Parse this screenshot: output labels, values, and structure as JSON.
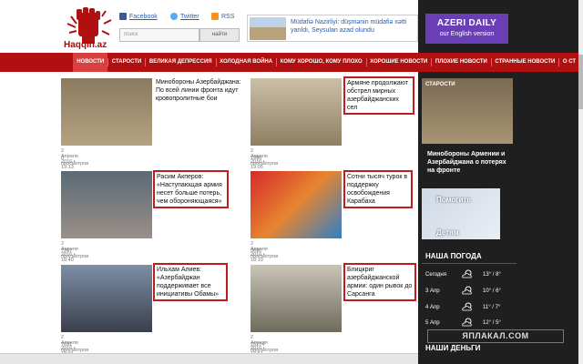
{
  "header": {
    "logo_text": "Haqqin.az",
    "facebook": "Facebook",
    "twitter": "Twitter",
    "rss": "RSS",
    "search_placeholder": "поиск",
    "search_button": "найти",
    "banner_text": "Müdafiə Nazirliyi: düşmənin müdafiə xətti yarıldı, Seysulan azad olundu",
    "azeri_title": "AZERI DAILY",
    "azeri_sub": "our English version"
  },
  "nav": [
    "НОВОСТИ",
    "СТАРОСТИ",
    "ВЕЛИКАЯ ДЕПРЕССИЯ",
    "ХОЛОДНАЯ ВОЙНА",
    "КОМУ ХОРОШО, КОМУ ПЛОХО",
    "ХОРОШИЕ НОВОСТИ",
    "ПЛОХИЕ НОВОСТИ",
    "СТРАННЫЕ НОВОСТИ",
    "О СТ"
  ],
  "cards": [
    {
      "title": "Минобороны Азербайджана: По всей линии фронта идут кровопролитные бои",
      "date": "2 Апреля 2016 • 19:13",
      "views": "0 просмотров"
    },
    {
      "title": "Армяне продолжают обстрел мирных азербайджанских сел",
      "date": "2 Апреля 2016 • 19:05",
      "views": "1990 просмотров"
    },
    {
      "title": "Расим Акперов: «Наступающая армия несет больше потерь, чем обороняющаяся»",
      "date": "2 Апреля 2016 • 18:40",
      "views": "7267 просмотров"
    },
    {
      "title": "Сотни тысяч турок в поддержку освобождения Карабаха",
      "date": "2 Апреля 2016 • 18:10",
      "views": "9690 просмотров"
    },
    {
      "title": "Ильхам Алиев: «Азербайджан поддерживает все инициативы Обамы»",
      "date": "2 Апреля 2016 • 18:01",
      "views": "7631 просмотров"
    },
    {
      "title": "Блицкриг азербайджанской армии: один рывок до Сарсанга",
      "date": "2 Апреля 2016 • 17:51",
      "views": "15274 просмотров"
    }
  ],
  "sidebar": {
    "image_label": "СТАРОСТИ",
    "caption": "Минобороны Армении и Азербайджана о потерях на фронте",
    "ad_top": "Помогите",
    "ad_bottom": "Детям",
    "weather_title": "НАША ПОГОДА",
    "weather": [
      {
        "day": "Сегодня",
        "temp": "13° / 8°"
      },
      {
        "day": "3 Апр",
        "temp": "10° / 6°"
      },
      {
        "day": "4 Апр",
        "temp": "11° / 7°"
      },
      {
        "day": "5 Апр",
        "temp": "12° / 5°"
      }
    ],
    "money_title": "НАШИ ДЕНЬГИ",
    "watermark": "ЯПЛАКАЛ.COM"
  },
  "colors": {
    "nav": "#b01010",
    "accent_box": "#c01c1c",
    "azeri": "#6a3fb5",
    "dark": "#1f1f1f"
  }
}
